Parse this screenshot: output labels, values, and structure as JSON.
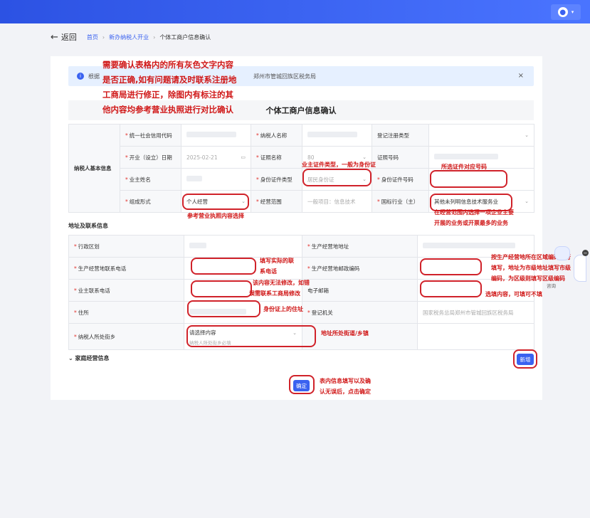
{
  "header": {
    "avatar_glyph": "●",
    "caret": "▾"
  },
  "breadcrumb": {
    "back_icon": "arrow-left-icon",
    "back_glyph": "←",
    "back_label": "返回",
    "home": "首页",
    "link": "新办纳税人开业",
    "sep": "›",
    "current": "个体工商户信息确认"
  },
  "notice": {
    "icon_glyph": "i",
    "text_start": "根据",
    "text_end": "郑州市管城回族区税务局",
    "close": "×"
  },
  "form": {
    "title": "个体工商户信息确认",
    "required_mark": "*",
    "section_basic": "纳税人基本信息",
    "labels": {
      "uscc": "统一社会信用代码",
      "taxpayer_name": "纳税人名称",
      "reg_type": "登记注册类型",
      "open_date": "开业（设立）日期",
      "license_name": "证照名称",
      "license_no": "证照号码",
      "owner_name": "业主姓名",
      "id_type": "身份证件类型",
      "id_no": "身份证件号码",
      "org_form": "组成形式",
      "biz_scope": "经营范围",
      "industry": "国标行业（主）"
    },
    "values": {
      "open_date": "2025-02-21",
      "license_name": "80",
      "id_type": "居民身份证",
      "org_form": "个人经营",
      "biz_scope": "一般项目：信息技术",
      "industry": "其他未列明信息技术服务业"
    },
    "icons": {
      "calendar": "calendar-icon",
      "chevron": "chevron-down-icon"
    },
    "glyphs": {
      "calendar": "▭",
      "chevron": "⌄"
    },
    "section_address": "地址及联系信息",
    "address_labels": {
      "admin_division": "行政区划",
      "biz_address": "生产经营地地址",
      "biz_phone": "生产经营地联系电话",
      "biz_postcode": "生产经营地邮政编码",
      "owner_phone": "业主联系电话",
      "email": "电子邮箱",
      "residence": "住所",
      "reg_authority": "登记机关",
      "town": "纳税人所处街乡"
    },
    "address_values": {
      "reg_authority": "国家税务总局郑州市管城回族区税务局",
      "town_placeholder": "请选择内容",
      "town_hint": "纳税人所处街乡必填"
    },
    "section_family": "家庭经营信息",
    "family_caret": "⌄",
    "add_button": "新增",
    "confirm_button": "确定"
  },
  "annotations": {
    "main": [
      "需要确认表格内的所有灰色文字内容",
      "是否正确,如有问题请及时联系注册地",
      "工商局进行修正，除图内有标注的其",
      "他内容均参考营业执照进行对比确认"
    ],
    "id_type": "业主证件类型，一般为身份证",
    "id_no": "所选证件对应号码",
    "org_form": "参考营业执照内容选择",
    "industry_1": "在经营范围内选择一项企业主要",
    "industry_2": "开展的业务或开票最多的业务",
    "biz_phone_1": "填写实际的联",
    "biz_phone_2": "系电话",
    "postcode_1": "按生产经营地所在区域编码进行",
    "postcode_2": "填写，地址为市级地址填写市级",
    "postcode_3": "编码，为区级则填写区级编码",
    "owner_phone_1": "该内容无法修改，如错",
    "owner_phone_2": "误需联系工商局修改",
    "email": "选填内容，可填可不填",
    "residence": "身份证上的住址",
    "town": "地址所处街道/乡镇",
    "confirm_1": "表内信息填写以及确",
    "confirm_2": "认无误后，点击确定"
  },
  "side": {
    "badge": "−",
    "tag": "咨询"
  }
}
